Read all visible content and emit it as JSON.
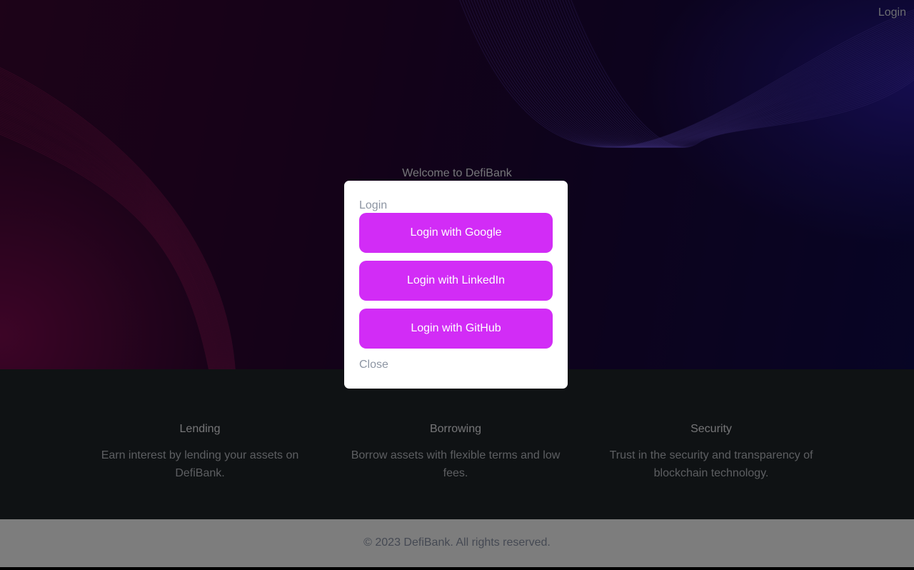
{
  "nav": {
    "login_label": "Login"
  },
  "hero": {
    "title": "Welcome to DefiBank"
  },
  "features": [
    {
      "title": "Lending",
      "description": "Earn interest by lending your assets on DefiBank."
    },
    {
      "title": "Borrowing",
      "description": "Borrow assets with flexible terms and low fees."
    },
    {
      "title": "Security",
      "description": "Trust in the security and transparency of blockchain technology."
    }
  ],
  "footer": {
    "copyright": "© 2023 DefiBank. All rights reserved."
  },
  "modal": {
    "title": "Login",
    "buttons": [
      {
        "label": "Login with Google"
      },
      {
        "label": "Login with LinkedIn"
      },
      {
        "label": "Login with GitHub"
      }
    ],
    "close_label": "Close"
  },
  "colors": {
    "accent": "#d22cf6",
    "hero_left": "#7a0a4e",
    "hero_right": "#2a1a9a",
    "features_bg": "#1f2428",
    "footer_bg": "#fbfbfb"
  }
}
